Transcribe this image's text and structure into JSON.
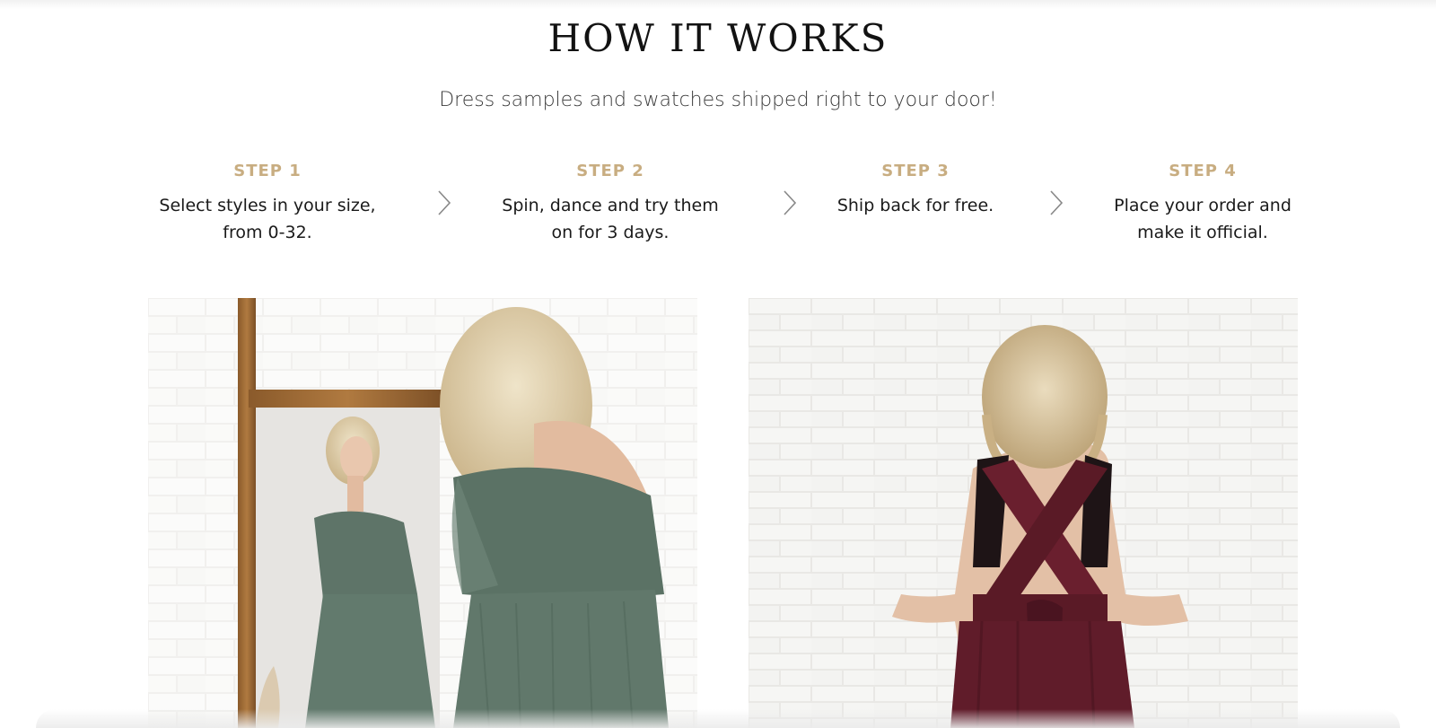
{
  "section": {
    "title": "HOW IT WORKS",
    "subtitle": "Dress samples and swatches shipped right to your door!"
  },
  "steps": [
    {
      "label": "STEP 1",
      "text": "Select styles in your size,\nfrom 0-32."
    },
    {
      "label": "STEP 2",
      "text": "Spin, dance and try them\non for 3 days."
    },
    {
      "label": "STEP 3",
      "text": "Ship back for free."
    },
    {
      "label": "STEP 4",
      "text": "Place your order and\nmake it official."
    }
  ],
  "icons": {
    "step_separator": "chevron-right-icon"
  },
  "images": [
    {
      "name": "mirror-try-on-photo",
      "dress_color": "#5e7468"
    },
    {
      "name": "back-view-dress-photo",
      "dress_color": "#5a1a26"
    }
  ],
  "colors": {
    "step_label": "#c8ad81",
    "title": "#121212",
    "body_text": "#1a1a1a"
  }
}
